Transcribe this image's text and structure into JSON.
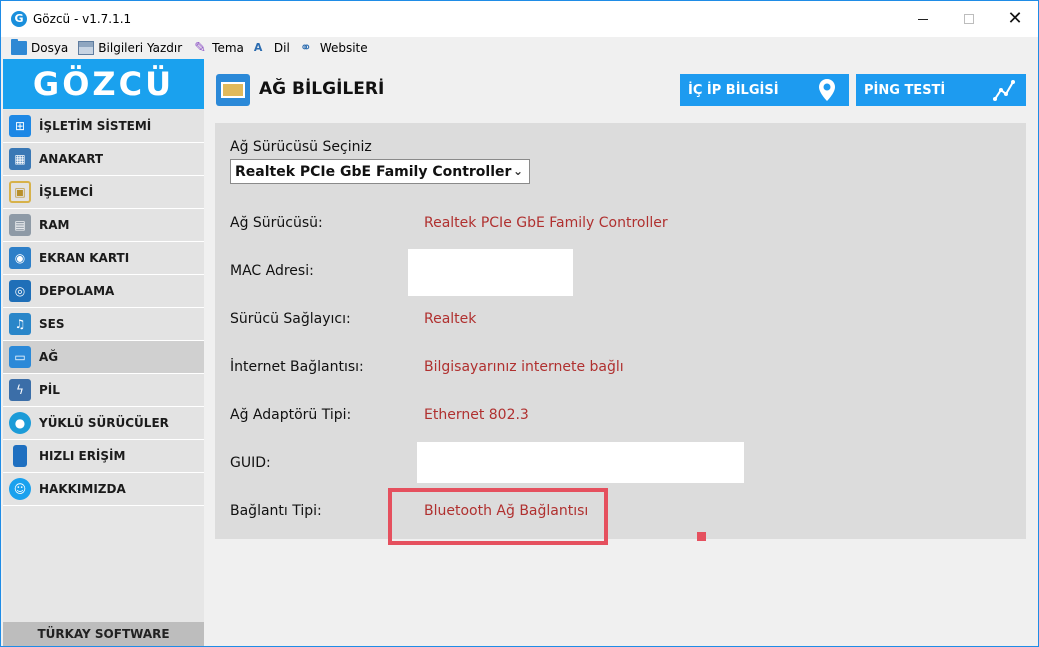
{
  "window": {
    "title": "Gözcü - v1.7.1.1",
    "logo_letter": "G"
  },
  "menu": [
    {
      "label": "Dosya",
      "icon": "folder-icon"
    },
    {
      "label": "Bilgileri Yazdır",
      "icon": "print-icon"
    },
    {
      "label": "Tema",
      "icon": "theme-icon"
    },
    {
      "label": "Dil",
      "icon": "language-icon"
    },
    {
      "label": "Website",
      "icon": "web-icon"
    }
  ],
  "sidebar": {
    "brand": "GÖZCÜ",
    "items": [
      {
        "label": "İŞLETİM SİSTEMİ",
        "icon": "windows-icon"
      },
      {
        "label": "ANAKART",
        "icon": "motherboard-icon"
      },
      {
        "label": "İŞLEMCİ",
        "icon": "cpu-icon"
      },
      {
        "label": "RAM",
        "icon": "ram-icon"
      },
      {
        "label": "EKRAN KARTI",
        "icon": "gpu-icon"
      },
      {
        "label": "DEPOLAMA",
        "icon": "storage-icon"
      },
      {
        "label": "SES",
        "icon": "speaker-icon"
      },
      {
        "label": "AĞ",
        "icon": "network-icon"
      },
      {
        "label": "PİL",
        "icon": "battery-icon"
      },
      {
        "label": "YÜKLÜ SÜRÜCÜLER",
        "icon": "drivers-icon"
      },
      {
        "label": "HIZLI ERİŞİM",
        "icon": "bookmark-icon"
      },
      {
        "label": "HAKKIMIZDA",
        "icon": "about-icon"
      }
    ],
    "active_index": 7,
    "footer": "TÜRKAY SOFTWARE"
  },
  "main": {
    "title": "AĞ BİLGİLERİ",
    "buttons": {
      "ip": "İÇ İP BİLGİSİ",
      "ping": "PİNG TESTİ"
    },
    "select_label": "Ağ Sürücüsü Seçiniz",
    "select_value": "Realtek PCIe GbE Family Controller",
    "rows": [
      {
        "label": "Ağ Sürücüsü:",
        "value": "Realtek PCIe GbE Family Controller"
      },
      {
        "label": "MAC Adresi:",
        "value": ""
      },
      {
        "label": "Sürücü Sağlayıcı:",
        "value": "Realtek"
      },
      {
        "label": "İnternet Bağlantısı:",
        "value": "Bilgisayarınız internete bağlı"
      },
      {
        "label": "Ağ Adaptörü Tipi:",
        "value": "Ethernet 802.3"
      },
      {
        "label": "GUID:",
        "value": ""
      },
      {
        "label": "Bağlantı Tipi:",
        "value": "Bluetooth Ağ Bağlantısı"
      }
    ]
  },
  "colors": {
    "accent": "#1d9bf0",
    "brand": "#1aa1ee",
    "value_text": "#b0302f",
    "highlight": "#e5505e"
  }
}
